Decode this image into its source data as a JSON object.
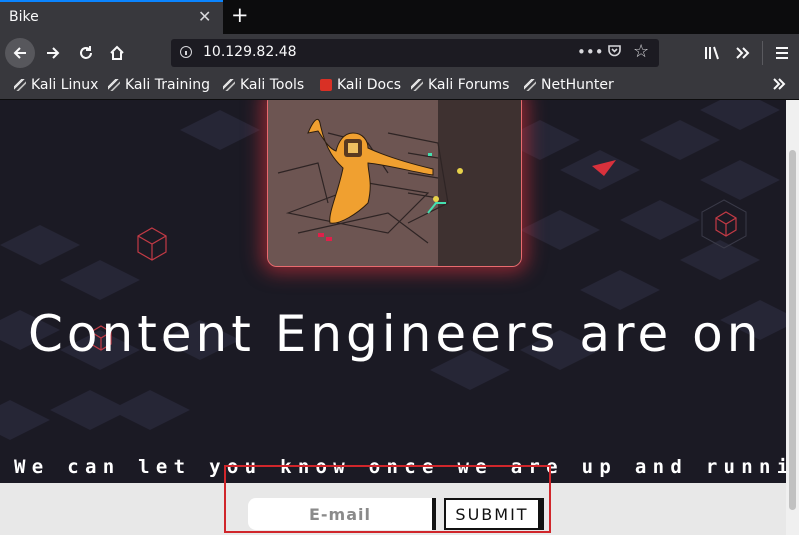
{
  "browser": {
    "tab_title": "Bike",
    "url": "10.129.82.48",
    "bookmarks": [
      {
        "label": "Kali Linux",
        "icon": "kali-dragon-icon"
      },
      {
        "label": "Kali Training",
        "icon": "kali-dragon-icon"
      },
      {
        "label": "Kali Tools",
        "icon": "kali-dragon-icon"
      },
      {
        "label": "Kali Docs",
        "icon": "kali-docs-icon"
      },
      {
        "label": "Kali Forums",
        "icon": "kali-dragon-icon"
      },
      {
        "label": "NetHunter",
        "icon": "nethunter-icon"
      }
    ]
  },
  "page": {
    "headline": "Content Engineers are on",
    "subline": "We can let you know once we are up and running.",
    "email_placeholder": "E-mail",
    "submit_label": "SUBMIT"
  },
  "colors": {
    "accent_red": "#d0262b",
    "background": "#1b1a24",
    "figure_orange": "#f0a030"
  }
}
